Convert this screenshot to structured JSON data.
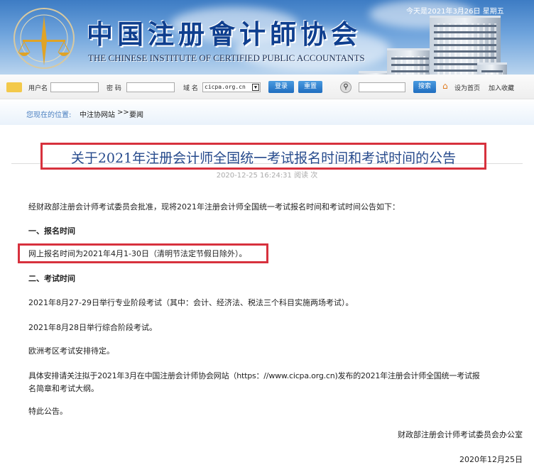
{
  "header": {
    "title_cn": "中国注册會计師协会",
    "title_en": "THE CHINESE INSTITUTE OF CERTIFIED PUBLIC ACCOUNTANTS",
    "date": "今天是2021年3月26日  星期五"
  },
  "toolbar": {
    "username_label": "用户名",
    "password_label": "密  码",
    "domain_label": "域  名",
    "domain_value": "cicpa.org.cn",
    "login": "登录",
    "reset": "重置",
    "search": "搜索",
    "set_home": "设为首页",
    "favorite": "加入收藏"
  },
  "breadcrumb": {
    "prefix": "您现在的位置:",
    "site": "中注协网站",
    "sep": ">>",
    "current": "要闻"
  },
  "article": {
    "title": "关于2021年注册会计师全国统一考试报名时间和考试时间的公告",
    "meta": "2020-12-25 16:24:31  阅读 次",
    "intro": "经财政部注册会计师考试委员会批准，现将2021年注册会计师全国统一考试报名时间和考试时间公告如下：",
    "h1": "一、报名时间",
    "reg": "网上报名时间为2021年4月1-30日（清明节法定节假日除外）。",
    "h2": "二、考试时间",
    "exam1": "2021年8月27-29日举行专业阶段考试（其中：会计、经济法、税法三个科目实施两场考试）。",
    "exam2": "2021年8月28日举行综合阶段考试。",
    "europe": "欧洲考区考试安排待定。",
    "detail1": "具体安排请关注拟于2021年3月在中国注册会计师协会网站（https：//www.cicpa.org.cn)发布的2021年注册会计师全国统一考试报",
    "detail2": "名简章和考试大纲。",
    "closing": "特此公告。",
    "signer": "财政部注册会计师考试委员会办公室",
    "sign_date": "2020年12月25日"
  }
}
